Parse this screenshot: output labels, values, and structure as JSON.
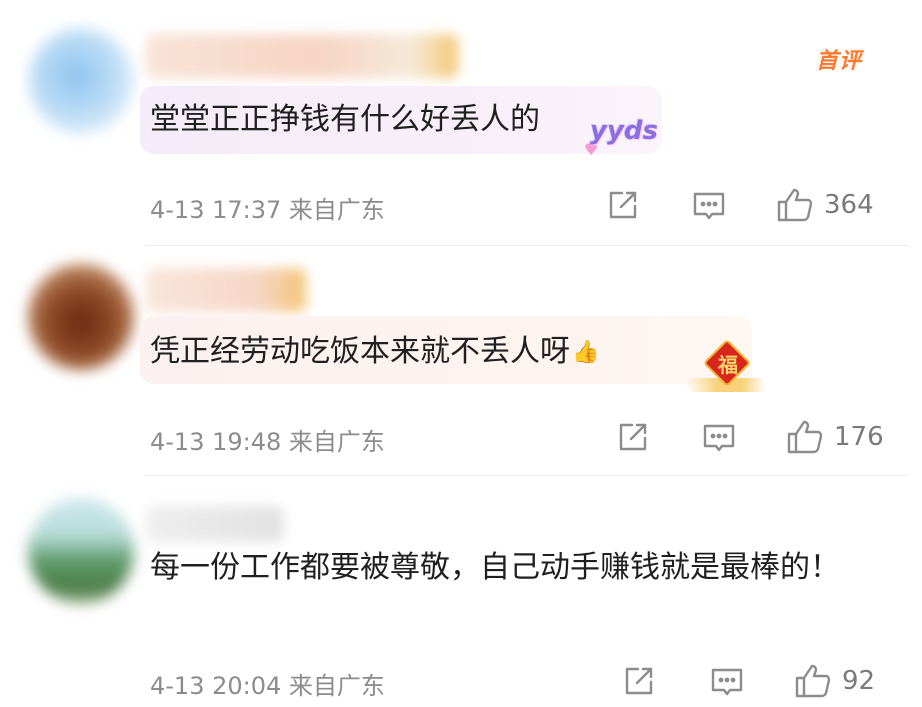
{
  "comments": [
    {
      "badge": "首评",
      "text": "堂堂正正挣钱有什么好丢人的",
      "sticker": "yyds",
      "time": "4-13 17:37",
      "location": "来自广东",
      "likes": "364"
    },
    {
      "text": "凭正经劳动吃饭本来就不丢人呀",
      "emoji": "👍",
      "sticker": "福",
      "time": "4-13 19:48",
      "location": "来自广东",
      "likes": "176"
    },
    {
      "text": "每一份工作都要被尊敬，自己动手赚钱就是最棒的！",
      "time": "4-13 20:04",
      "location": "来自广东",
      "likes": "92"
    }
  ],
  "icons": {
    "share": "share-icon",
    "reply": "comment-icon",
    "like": "thumbs-up-icon"
  },
  "colors": {
    "badge": "#ff7a2e",
    "meta_text": "#8c8c8c",
    "divider": "#ececec"
  }
}
